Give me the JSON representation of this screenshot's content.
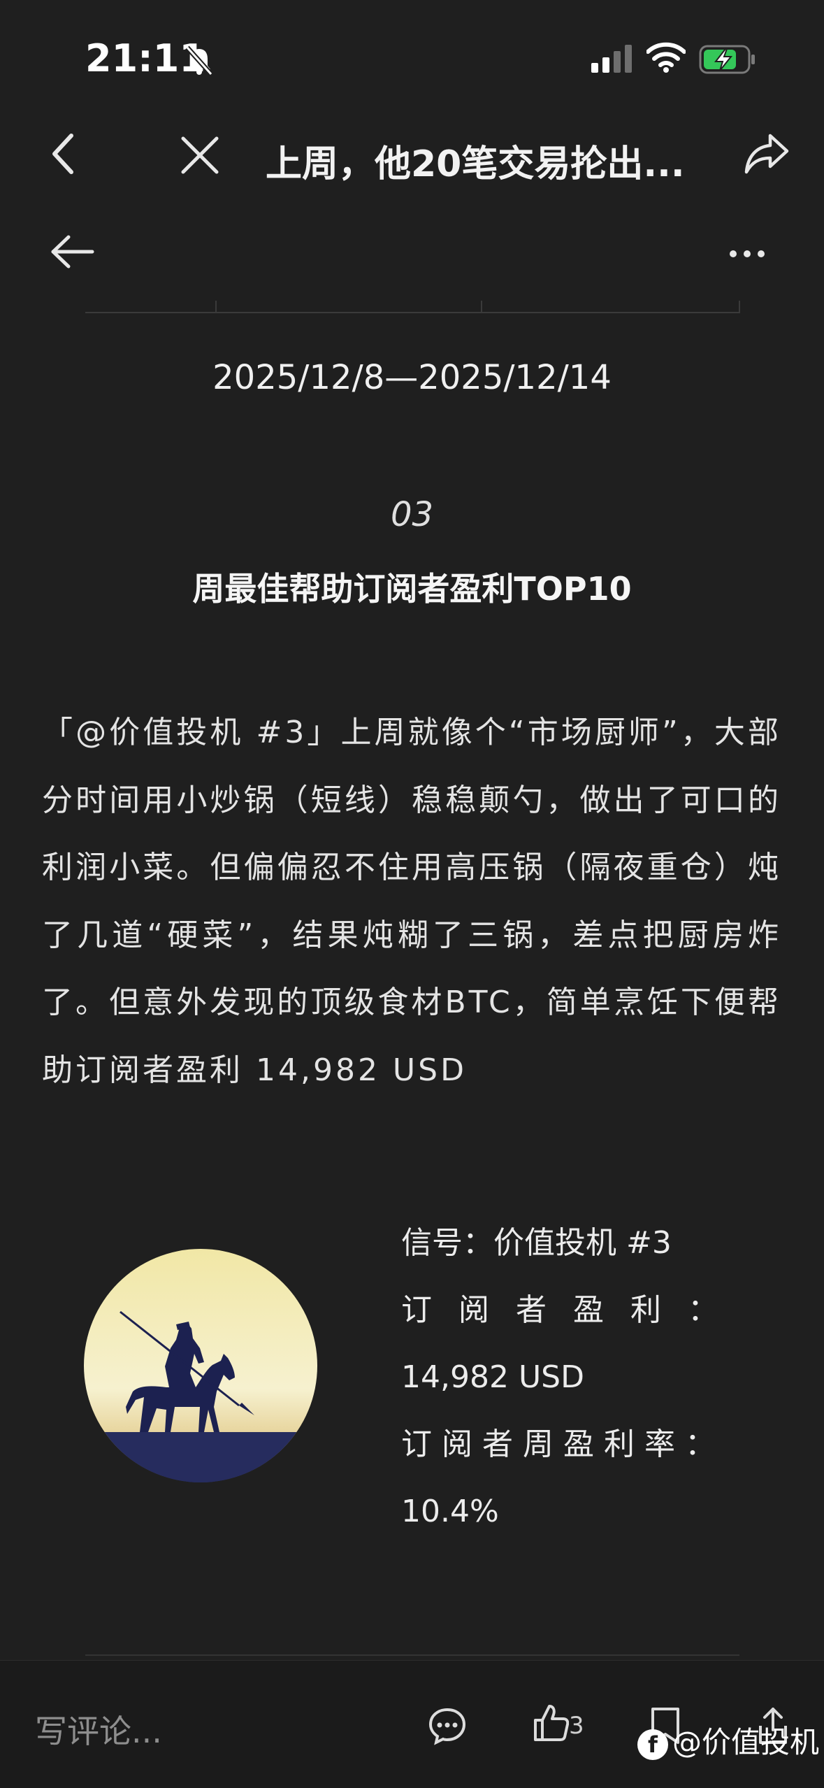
{
  "status_bar": {
    "time": "21:11"
  },
  "nav": {
    "title": "上周，他20笔交易抡出..."
  },
  "article": {
    "date_range": "2025/12/8—2025/12/14",
    "section_number": "03",
    "section_title": "周最佳帮助订阅者盈利TOP10",
    "body": "「@价值投机 #3」上周就像个“市场厨师”，大部分时间用小炒锅（短线）稳稳颠勺，做出了可口的利润小菜。但偏偏忍不住用高压锅（隔夜重仓）炖了几道“硬菜”，结果炖糊了三锅，差点把厨房炸了。但意外发现的顶级食材BTC，简单烹饪下便帮助订阅者盈利 14,982 USD",
    "signal_card": {
      "signal_label": "信号：价值投机 #3",
      "profit_label": "订阅者盈利：",
      "profit_value": "14,982 USD",
      "rate_label": "订阅者周盈利率：",
      "rate_value": "10.4%"
    }
  },
  "bottom_bar": {
    "comment_placeholder": "写评论...",
    "like_count": "3",
    "watermark": "@价值投机"
  },
  "icons": {
    "status": [
      "bell-muted-icon",
      "signal-icon",
      "wifi-icon",
      "battery-charging-icon"
    ],
    "nav": [
      "chevron-left-icon",
      "close-icon",
      "share-icon",
      "arrow-left-icon",
      "more-icon"
    ],
    "bottom": [
      "comment-icon",
      "like-icon",
      "favorite-icon",
      "share-up-icon"
    ]
  },
  "colors": {
    "background": "#1f1f1f",
    "battery": "#34c759",
    "text": "#e6e6e6"
  }
}
